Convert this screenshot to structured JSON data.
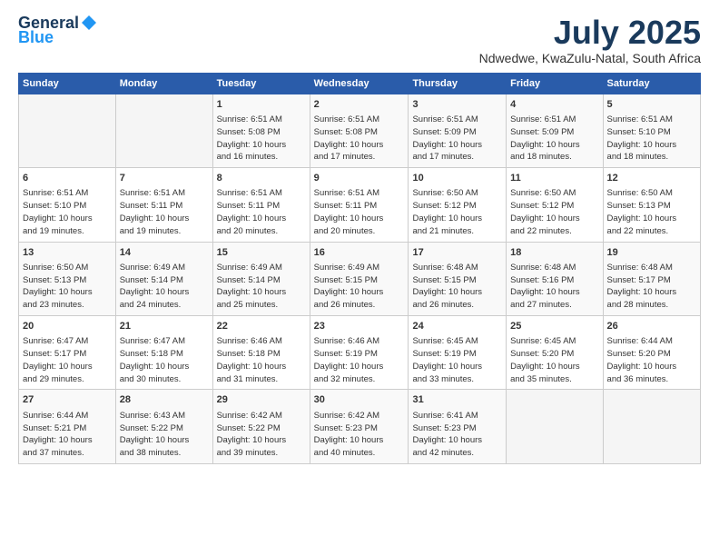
{
  "header": {
    "logo_line1": "General",
    "logo_line2": "Blue",
    "title": "July 2025",
    "location": "Ndwedwe, KwaZulu-Natal, South Africa"
  },
  "weekdays": [
    "Sunday",
    "Monday",
    "Tuesday",
    "Wednesday",
    "Thursday",
    "Friday",
    "Saturday"
  ],
  "weeks": [
    [
      {
        "day": "",
        "info": ""
      },
      {
        "day": "",
        "info": ""
      },
      {
        "day": "1",
        "info": "Sunrise: 6:51 AM\nSunset: 5:08 PM\nDaylight: 10 hours\nand 16 minutes."
      },
      {
        "day": "2",
        "info": "Sunrise: 6:51 AM\nSunset: 5:08 PM\nDaylight: 10 hours\nand 17 minutes."
      },
      {
        "day": "3",
        "info": "Sunrise: 6:51 AM\nSunset: 5:09 PM\nDaylight: 10 hours\nand 17 minutes."
      },
      {
        "day": "4",
        "info": "Sunrise: 6:51 AM\nSunset: 5:09 PM\nDaylight: 10 hours\nand 18 minutes."
      },
      {
        "day": "5",
        "info": "Sunrise: 6:51 AM\nSunset: 5:10 PM\nDaylight: 10 hours\nand 18 minutes."
      }
    ],
    [
      {
        "day": "6",
        "info": "Sunrise: 6:51 AM\nSunset: 5:10 PM\nDaylight: 10 hours\nand 19 minutes."
      },
      {
        "day": "7",
        "info": "Sunrise: 6:51 AM\nSunset: 5:11 PM\nDaylight: 10 hours\nand 19 minutes."
      },
      {
        "day": "8",
        "info": "Sunrise: 6:51 AM\nSunset: 5:11 PM\nDaylight: 10 hours\nand 20 minutes."
      },
      {
        "day": "9",
        "info": "Sunrise: 6:51 AM\nSunset: 5:11 PM\nDaylight: 10 hours\nand 20 minutes."
      },
      {
        "day": "10",
        "info": "Sunrise: 6:50 AM\nSunset: 5:12 PM\nDaylight: 10 hours\nand 21 minutes."
      },
      {
        "day": "11",
        "info": "Sunrise: 6:50 AM\nSunset: 5:12 PM\nDaylight: 10 hours\nand 22 minutes."
      },
      {
        "day": "12",
        "info": "Sunrise: 6:50 AM\nSunset: 5:13 PM\nDaylight: 10 hours\nand 22 minutes."
      }
    ],
    [
      {
        "day": "13",
        "info": "Sunrise: 6:50 AM\nSunset: 5:13 PM\nDaylight: 10 hours\nand 23 minutes."
      },
      {
        "day": "14",
        "info": "Sunrise: 6:49 AM\nSunset: 5:14 PM\nDaylight: 10 hours\nand 24 minutes."
      },
      {
        "day": "15",
        "info": "Sunrise: 6:49 AM\nSunset: 5:14 PM\nDaylight: 10 hours\nand 25 minutes."
      },
      {
        "day": "16",
        "info": "Sunrise: 6:49 AM\nSunset: 5:15 PM\nDaylight: 10 hours\nand 26 minutes."
      },
      {
        "day": "17",
        "info": "Sunrise: 6:48 AM\nSunset: 5:15 PM\nDaylight: 10 hours\nand 26 minutes."
      },
      {
        "day": "18",
        "info": "Sunrise: 6:48 AM\nSunset: 5:16 PM\nDaylight: 10 hours\nand 27 minutes."
      },
      {
        "day": "19",
        "info": "Sunrise: 6:48 AM\nSunset: 5:17 PM\nDaylight: 10 hours\nand 28 minutes."
      }
    ],
    [
      {
        "day": "20",
        "info": "Sunrise: 6:47 AM\nSunset: 5:17 PM\nDaylight: 10 hours\nand 29 minutes."
      },
      {
        "day": "21",
        "info": "Sunrise: 6:47 AM\nSunset: 5:18 PM\nDaylight: 10 hours\nand 30 minutes."
      },
      {
        "day": "22",
        "info": "Sunrise: 6:46 AM\nSunset: 5:18 PM\nDaylight: 10 hours\nand 31 minutes."
      },
      {
        "day": "23",
        "info": "Sunrise: 6:46 AM\nSunset: 5:19 PM\nDaylight: 10 hours\nand 32 minutes."
      },
      {
        "day": "24",
        "info": "Sunrise: 6:45 AM\nSunset: 5:19 PM\nDaylight: 10 hours\nand 33 minutes."
      },
      {
        "day": "25",
        "info": "Sunrise: 6:45 AM\nSunset: 5:20 PM\nDaylight: 10 hours\nand 35 minutes."
      },
      {
        "day": "26",
        "info": "Sunrise: 6:44 AM\nSunset: 5:20 PM\nDaylight: 10 hours\nand 36 minutes."
      }
    ],
    [
      {
        "day": "27",
        "info": "Sunrise: 6:44 AM\nSunset: 5:21 PM\nDaylight: 10 hours\nand 37 minutes."
      },
      {
        "day": "28",
        "info": "Sunrise: 6:43 AM\nSunset: 5:22 PM\nDaylight: 10 hours\nand 38 minutes."
      },
      {
        "day": "29",
        "info": "Sunrise: 6:42 AM\nSunset: 5:22 PM\nDaylight: 10 hours\nand 39 minutes."
      },
      {
        "day": "30",
        "info": "Sunrise: 6:42 AM\nSunset: 5:23 PM\nDaylight: 10 hours\nand 40 minutes."
      },
      {
        "day": "31",
        "info": "Sunrise: 6:41 AM\nSunset: 5:23 PM\nDaylight: 10 hours\nand 42 minutes."
      },
      {
        "day": "",
        "info": ""
      },
      {
        "day": "",
        "info": ""
      }
    ]
  ]
}
